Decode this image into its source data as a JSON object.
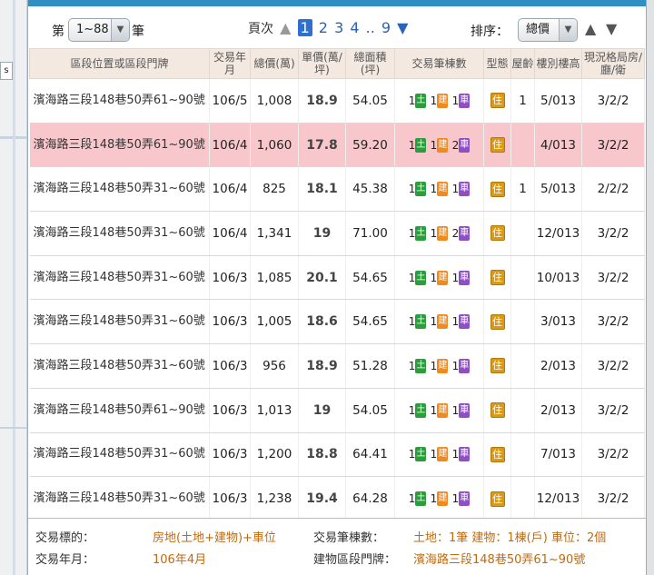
{
  "controls": {
    "per_page_prefix": "第",
    "per_page_value": "1~88",
    "per_page_suffix": "筆",
    "page_label": "頁次",
    "pages": [
      "1",
      "2",
      "3",
      "4",
      "..",
      "9"
    ],
    "current_page": "1",
    "sort_label": "排序：",
    "sort_value": "總價"
  },
  "table": {
    "headers": [
      "區段位置或區段門牌",
      "交易年月",
      "總價(萬)",
      "單價(萬/坪)",
      "總面積(坪)",
      "交易筆棟數",
      "型態",
      "屋齡",
      "樓別樓高",
      "現況格局房/廳/衛"
    ],
    "land_char": "土",
    "building_char": "建",
    "car_char": "車",
    "usage_char": "住",
    "rows": [
      {
        "address": "濱海路三段148巷50弄61~90號",
        "date": "106/5",
        "total": "1,008",
        "unit": "18.9",
        "area": "54.05",
        "land": "1",
        "building": "1",
        "car": "1",
        "age": "1",
        "floor": "5/013",
        "layout": "3/2/2",
        "highlight": false
      },
      {
        "address": "濱海路三段148巷50弄61~90號",
        "date": "106/4",
        "total": "1,060",
        "unit": "17.8",
        "area": "59.20",
        "land": "1",
        "building": "1",
        "car": "2",
        "age": "",
        "floor": "4/013",
        "layout": "3/2/2",
        "highlight": true
      },
      {
        "address": "濱海路三段148巷50弄31~60號",
        "date": "106/4",
        "total": "825",
        "unit": "18.1",
        "area": "45.38",
        "land": "1",
        "building": "1",
        "car": "1",
        "age": "1",
        "floor": "5/013",
        "layout": "2/2/2",
        "highlight": false
      },
      {
        "address": "濱海路三段148巷50弄31~60號",
        "date": "106/4",
        "total": "1,341",
        "unit": "19",
        "area": "71.00",
        "land": "1",
        "building": "1",
        "car": "2",
        "age": "",
        "floor": "12/013",
        "layout": "3/2/2",
        "highlight": false
      },
      {
        "address": "濱海路三段148巷50弄31~60號",
        "date": "106/3",
        "total": "1,085",
        "unit": "20.1",
        "area": "54.65",
        "land": "1",
        "building": "1",
        "car": "1",
        "age": "",
        "floor": "10/013",
        "layout": "3/2/2",
        "highlight": false
      },
      {
        "address": "濱海路三段148巷50弄31~60號",
        "date": "106/3",
        "total": "1,005",
        "unit": "18.6",
        "area": "54.65",
        "land": "1",
        "building": "1",
        "car": "1",
        "age": "",
        "floor": "3/013",
        "layout": "3/2/2",
        "highlight": false
      },
      {
        "address": "濱海路三段148巷50弄31~60號",
        "date": "106/3",
        "total": "956",
        "unit": "18.9",
        "area": "51.28",
        "land": "1",
        "building": "1",
        "car": "1",
        "age": "",
        "floor": "2/013",
        "layout": "3/2/2",
        "highlight": false
      },
      {
        "address": "濱海路三段148巷50弄61~90號",
        "date": "106/3",
        "total": "1,013",
        "unit": "19",
        "area": "54.05",
        "land": "1",
        "building": "1",
        "car": "1",
        "age": "",
        "floor": "2/013",
        "layout": "3/2/2",
        "highlight": false
      },
      {
        "address": "濱海路三段148巷50弄31~60號",
        "date": "106/3",
        "total": "1,200",
        "unit": "18.8",
        "area": "64.41",
        "land": "1",
        "building": "1",
        "car": "1",
        "age": "",
        "floor": "7/013",
        "layout": "3/2/2",
        "highlight": false
      },
      {
        "address": "濱海路三段148巷50弄31~60號",
        "date": "106/3",
        "total": "1,238",
        "unit": "19.4",
        "area": "64.28",
        "land": "1",
        "building": "1",
        "car": "1",
        "age": "",
        "floor": "12/013",
        "layout": "3/2/2",
        "highlight": false
      }
    ]
  },
  "details": {
    "target_label": "交易標的：",
    "target_value": "房地(土地+建物)+車位",
    "count_label": "交易筆棟數：",
    "count_value": "土地：1筆 建物：1棟(戶) 車位：2個",
    "date_label": "交易年月：",
    "date_value": "106年4月",
    "address_label": "建物區段門牌：",
    "address_value": "濱海路三段148巷50弄61~90號"
  }
}
